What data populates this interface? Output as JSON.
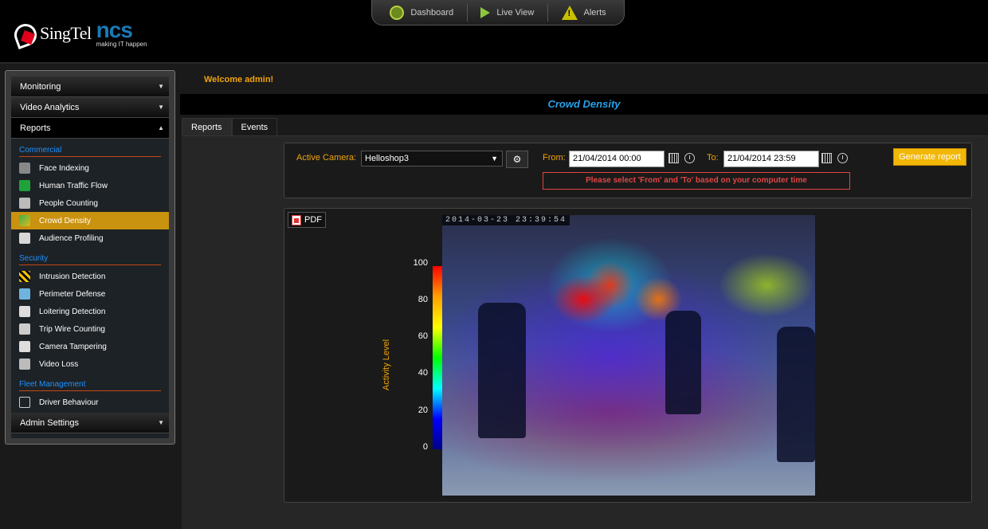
{
  "header": {
    "brand_singtel": "SingTel",
    "brand_ncs": "ncs",
    "brand_tagline": "making IT happen",
    "nav": [
      {
        "label": "Dashboard",
        "icon": "dashboard-icon"
      },
      {
        "label": "Live View",
        "icon": "play-icon"
      },
      {
        "label": "Alerts",
        "icon": "alert-icon"
      }
    ]
  },
  "sidebar": {
    "sections": {
      "monitoring": "Monitoring",
      "video_analytics": "Video Analytics",
      "reports": "Reports",
      "admin_settings": "Admin Settings"
    },
    "groups": {
      "commercial": {
        "label": "Commercial",
        "items": [
          "Face Indexing",
          "Human Traffic Flow",
          "People Counting",
          "Crowd Density",
          "Audience Profiling"
        ]
      },
      "security": {
        "label": "Security",
        "items": [
          "Intrusion Detection",
          "Perimeter Defense",
          "Loitering Detection",
          "Trip Wire Counting",
          "Camera Tampering",
          "Video Loss"
        ]
      },
      "fleet": {
        "label": "Fleet Management",
        "items": [
          "Driver Behaviour"
        ]
      }
    },
    "active_item": "Crowd Density"
  },
  "main": {
    "welcome": "Welcome admin!",
    "title": "Crowd Density",
    "tabs": [
      "Reports",
      "Events"
    ],
    "filters": {
      "camera_label": "Active Camera:",
      "camera_value": "Helloshop3",
      "from_label": "From:",
      "from_value": "21/04/2014 00:00",
      "to_label": "To:",
      "to_value": "21/04/2014 23:59",
      "generate_label": "Generate report",
      "notice": "Please select 'From' and 'To' based on your computer time"
    },
    "report": {
      "pdf_label": "PDF",
      "timestamp": "2014-03-23 23:39:54",
      "axis_label": "Activity  Level",
      "ticks": [
        "100",
        "80",
        "60",
        "40",
        "20",
        "0"
      ]
    }
  },
  "colors": {
    "accent_orange": "#f0a30a",
    "title_blue": "#29a0e8",
    "active_item": "#c9920f",
    "button_yellow": "#f2b707",
    "notice_red": "#e04646"
  }
}
